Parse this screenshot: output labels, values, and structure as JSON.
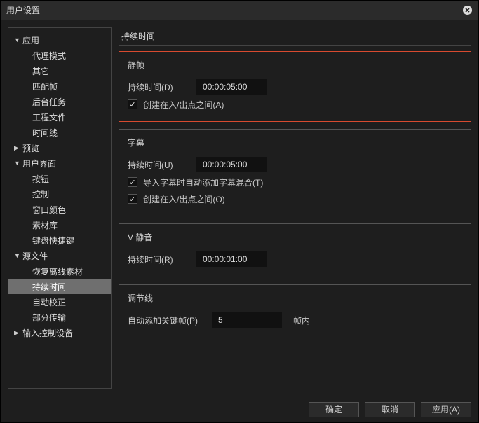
{
  "dialog": {
    "title": "用户设置"
  },
  "sidebar": {
    "nodes": [
      {
        "label": "应用",
        "expanded": true,
        "children": [
          {
            "label": "代理模式"
          },
          {
            "label": "其它"
          },
          {
            "label": "匹配帧"
          },
          {
            "label": "后台任务"
          },
          {
            "label": "工程文件"
          },
          {
            "label": "时间线"
          }
        ]
      },
      {
        "label": "预览",
        "expanded": false
      },
      {
        "label": "用户界面",
        "expanded": true,
        "children": [
          {
            "label": "按钮"
          },
          {
            "label": "控制"
          },
          {
            "label": "窗口颜色"
          },
          {
            "label": "素材库"
          },
          {
            "label": "键盘快捷键"
          }
        ]
      },
      {
        "label": "源文件",
        "expanded": true,
        "children": [
          {
            "label": "恢复离线素材"
          },
          {
            "label": "持续时间",
            "selected": true
          },
          {
            "label": "自动校正"
          },
          {
            "label": "部分传输"
          }
        ]
      },
      {
        "label": "输入控制设备",
        "expanded": false
      }
    ]
  },
  "content": {
    "heading": "持续时间",
    "groups": {
      "still": {
        "title": "静帧",
        "duration_label": "持续时间(D)",
        "duration_value": "00:00:05:00",
        "checkbox_label": "创建在入/出点之间(A)",
        "checkbox_checked": true
      },
      "subtitle": {
        "title": "字幕",
        "duration_label": "持续时间(U)",
        "duration_value": "00:00:05:00",
        "checkbox1_label": "导入字幕时自动添加字幕混合(T)",
        "checkbox1_checked": true,
        "checkbox2_label": "创建在入/出点之间(O)",
        "checkbox2_checked": true
      },
      "vmute": {
        "title": "V 静音",
        "duration_label": "持续时间(R)",
        "duration_value": "00:00:01:00"
      },
      "adjust": {
        "title": "调节线",
        "label": "自动添加关键帧(P)",
        "value": "5",
        "suffix": "帧内"
      }
    }
  },
  "footer": {
    "ok": "确定",
    "cancel": "取消",
    "apply": "应用(A)"
  }
}
